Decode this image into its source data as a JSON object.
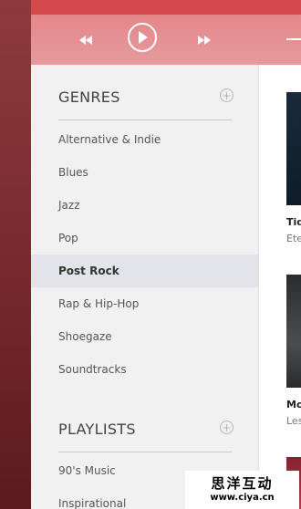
{
  "player": {
    "controls": {
      "rewind_icon": "rewind-icon",
      "play_icon": "play-icon",
      "forward_icon": "fast-forward-icon"
    }
  },
  "sidebar": {
    "genres_title": "GENRES",
    "genres": [
      {
        "label": "Alternative & Indie"
      },
      {
        "label": "Blues"
      },
      {
        "label": "Jazz"
      },
      {
        "label": "Pop"
      },
      {
        "label": "Post Rock",
        "active": true
      },
      {
        "label": "Rap & Hip-Hop"
      },
      {
        "label": "Shoegaze"
      },
      {
        "label": "Soundtracks"
      }
    ],
    "playlists_title": "PLAYLISTS",
    "playlists": [
      {
        "label": "90's Music"
      },
      {
        "label": "Inspirational"
      }
    ]
  },
  "content": {
    "albums": [
      {
        "title": "Tid",
        "subtitle": "Ete"
      },
      {
        "title": "Mo",
        "subtitle": "Les"
      }
    ]
  },
  "watermark": {
    "chinese": "思洋互动",
    "url": "www.ciya.cn"
  },
  "colors": {
    "accent": "#d4484e",
    "player_bar": "#e5878a",
    "sidebar_bg": "#f1f1f2",
    "active_item_bg": "#e2e4e9"
  }
}
